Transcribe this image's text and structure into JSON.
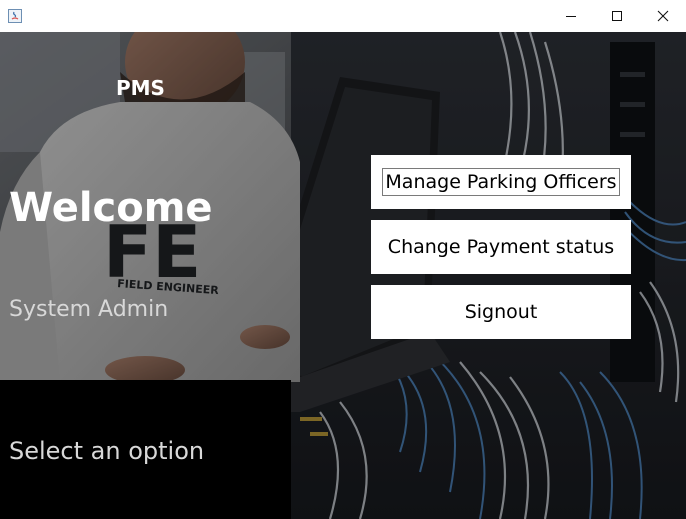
{
  "window": {
    "title": "",
    "controls": {
      "minimize_icon": "minimize-icon",
      "maximize_icon": "maximize-icon",
      "close_icon": "close-icon"
    }
  },
  "sidebar": {
    "app_name": "PMS",
    "welcome": "Welcome",
    "role": "System Admin",
    "prompt": "Select an option",
    "shirt_text": "FE",
    "shirt_subtext": "FIELD ENGINEER"
  },
  "menu": {
    "buttons": [
      {
        "label": "Manage Parking Officers",
        "focused": true
      },
      {
        "label": "Change Payment status"
      },
      {
        "label": "Signout"
      }
    ]
  },
  "colors": {
    "panel_black": "#000000",
    "button_bg": "#ffffff",
    "text_white": "#ffffff",
    "text_grey": "#d8d8d8"
  }
}
